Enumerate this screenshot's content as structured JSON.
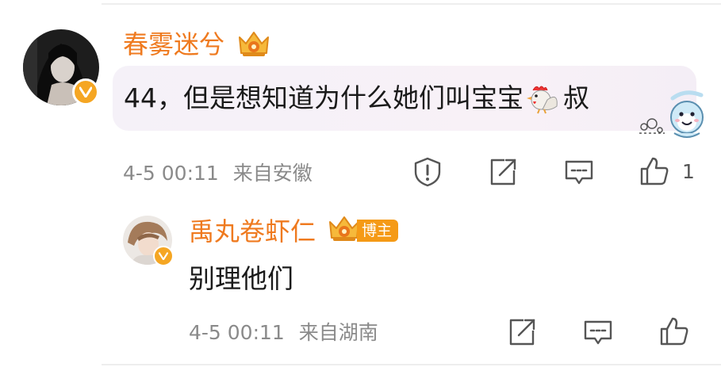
{
  "comment": {
    "username": "春雾迷兮",
    "text_before": "44，但是想知道为什么她们叫宝宝",
    "text_after": "叔",
    "timestamp": "4-5 00:11",
    "location": "来自安徽",
    "like_count": "1"
  },
  "reply": {
    "username": "禹丸卷虾仁",
    "host_badge": "博主",
    "text": "别理他们",
    "timestamp": "4-5 00:11",
    "location": "来自湖南"
  },
  "colors": {
    "username": "#ef7a1f",
    "verified": "#f5a623",
    "meta_text": "#8a8a8a",
    "icon_stroke": "#555555"
  },
  "icons": {
    "report": "exclamation-shield-icon",
    "share": "share-arrow-icon",
    "reply": "comment-bubble-icon",
    "like": "thumbs-up-icon"
  }
}
